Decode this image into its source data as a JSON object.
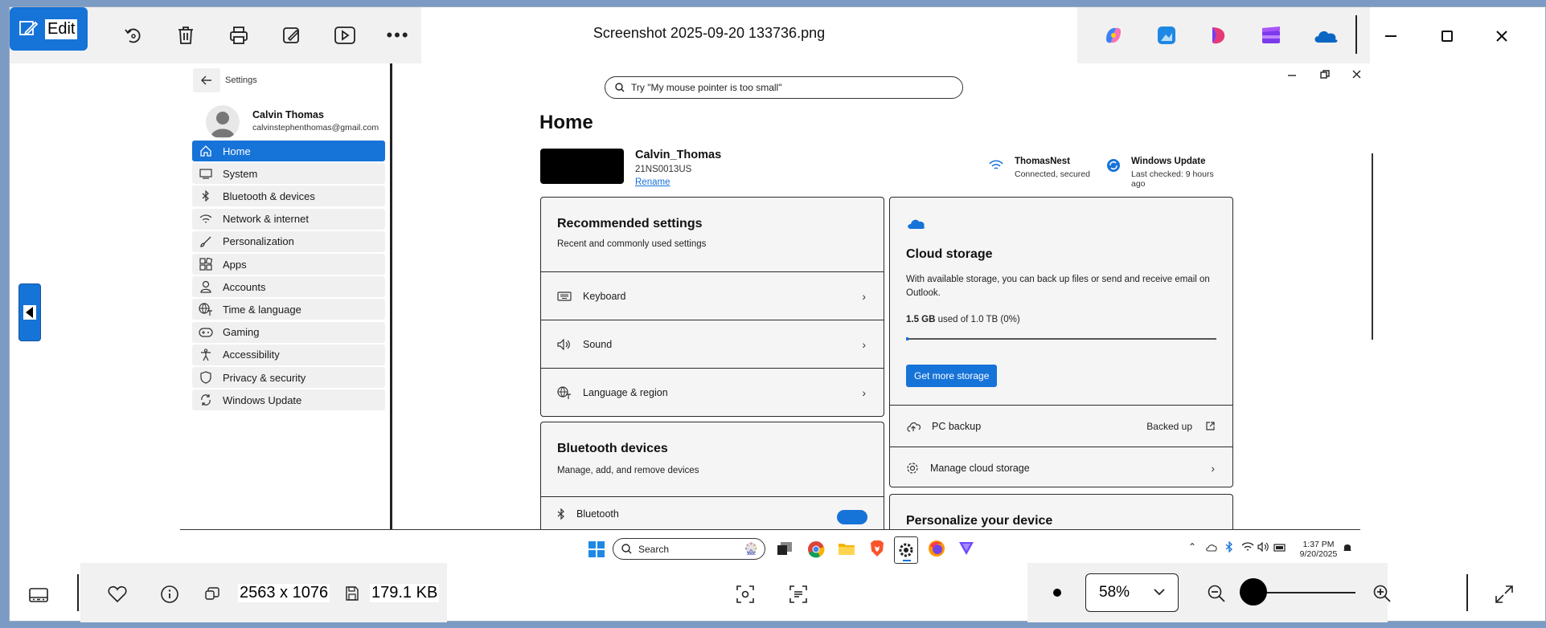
{
  "window": {
    "title": "Screenshot 2025-09-20 133736.png",
    "edit_label": "Edit",
    "accent": "#1673d8"
  },
  "toolbar_icons": [
    "edit-icon",
    "rotate-icon",
    "delete-icon",
    "print-icon",
    "draw-icon",
    "slideshow-icon",
    "more-icon"
  ],
  "app_icons": [
    "copilot-icon",
    "photos-icon",
    "designer-icon",
    "clipchamp-icon",
    "onedrive-icon"
  ],
  "settings": {
    "back_title": "Settings",
    "search_placeholder": "Try \"My mouse pointer is too small\"",
    "user_name": "Calvin Thomas",
    "user_email": "calvinstephenthomas@gmail.com",
    "nav": [
      {
        "label": "Home",
        "icon": "home-icon",
        "active": true
      },
      {
        "label": "System",
        "icon": "system-icon"
      },
      {
        "label": "Bluetooth & devices",
        "icon": "bluetooth-icon"
      },
      {
        "label": "Network & internet",
        "icon": "wifi-icon"
      },
      {
        "label": "Personalization",
        "icon": "brush-icon"
      },
      {
        "label": "Apps",
        "icon": "apps-icon"
      },
      {
        "label": "Accounts",
        "icon": "person-icon"
      },
      {
        "label": "Time & language",
        "icon": "globe-icon"
      },
      {
        "label": "Gaming",
        "icon": "gamepad-icon"
      },
      {
        "label": "Accessibility",
        "icon": "accessibility-icon"
      },
      {
        "label": "Privacy & security",
        "icon": "shield-icon"
      },
      {
        "label": "Windows Update",
        "icon": "update-icon"
      }
    ],
    "page_title": "Home",
    "device": {
      "name": "Calvin_Thomas",
      "model": "21NS0013US",
      "rename": "Rename"
    },
    "wifi": {
      "name": "ThomasNest",
      "status": "Connected, secured"
    },
    "update": {
      "name": "Windows Update",
      "status": "Last checked: 9 hours ago"
    },
    "recommended": {
      "title": "Recommended settings",
      "subtitle": "Recent and commonly used settings",
      "items": [
        "Keyboard",
        "Sound",
        "Language & region"
      ]
    },
    "bluetooth": {
      "title": "Bluetooth devices",
      "subtitle": "Manage, add, and remove devices",
      "item": "Bluetooth"
    },
    "cloud": {
      "title": "Cloud storage",
      "desc": "With available storage, you can back up files or send and receive email on Outlook.",
      "used": "1.5 GB",
      "used_rest": "used of 1.0 TB (0%)",
      "usage_fraction": 0.0,
      "button": "Get more storage",
      "backup_label": "PC backup",
      "backup_status": "Backed up",
      "manage_label": "Manage cloud storage"
    },
    "personalize_peek": "Personalize your device"
  },
  "taskbar": {
    "search": "Search",
    "time": "1:37 PM",
    "date": "9/20/2025"
  },
  "bottom": {
    "dimensions": "2563 x 1076",
    "filesize": "179.1 KB",
    "zoom": "58%",
    "zoom_level": 0.58
  }
}
